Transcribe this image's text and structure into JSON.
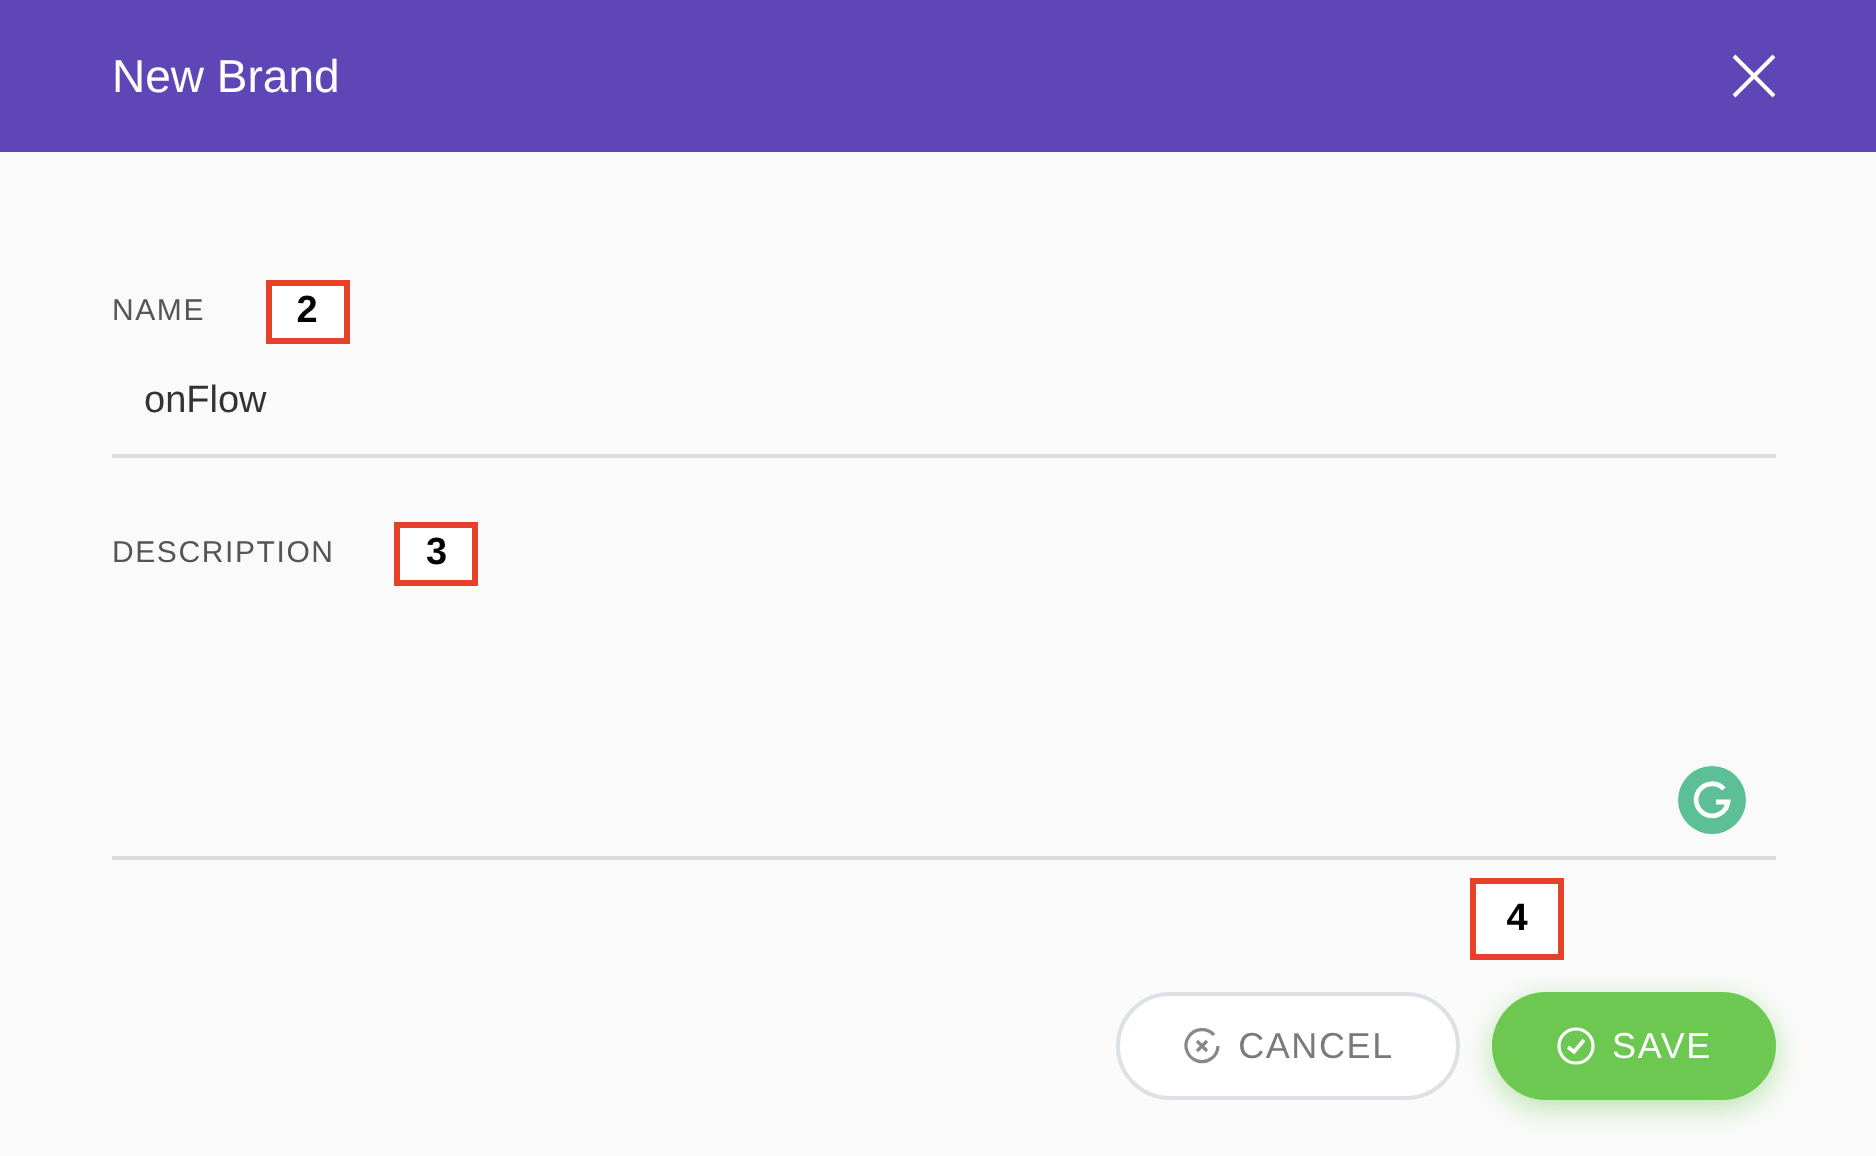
{
  "dialog": {
    "title": "New Brand"
  },
  "fields": [
    {
      "kind": "input",
      "label": "NAME",
      "value": "onFlow",
      "annotation": "2"
    },
    {
      "kind": "textarea",
      "label": "DESCRIPTION",
      "annotation": "3"
    }
  ],
  "button_annotation": "4",
  "buttons": [
    {
      "kind": "secondary",
      "label": "CANCEL"
    },
    {
      "kind": "primary",
      "label": "SAVE"
    }
  ]
}
